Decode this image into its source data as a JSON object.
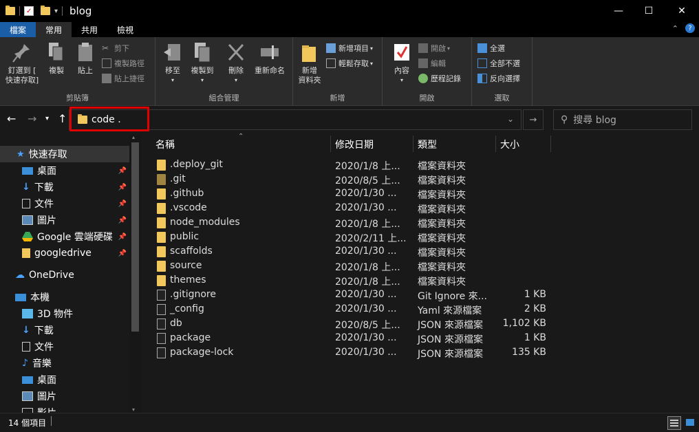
{
  "window": {
    "title": "blog",
    "minimize": "—",
    "maximize": "☐",
    "close": "✕"
  },
  "tabs": [
    {
      "label": "檔案"
    },
    {
      "label": "常用"
    },
    {
      "label": "共用"
    },
    {
      "label": "檢視"
    }
  ],
  "ribbon": {
    "clipboard": {
      "label": "剪貼簿",
      "pin_line1": "釘選到 [",
      "pin_line2": "快速存取]",
      "copy": "複製",
      "paste": "貼上",
      "cut": "剪下",
      "copy_path": "複製路徑",
      "paste_shortcut": "貼上捷徑"
    },
    "organize": {
      "label": "組合管理",
      "move_to": "移至",
      "copy_to": "複製到",
      "delete": "刪除",
      "rename": "重新命名"
    },
    "new": {
      "label": "新增",
      "new_folder_line1": "新增",
      "new_folder_line2": "資料夾",
      "new_item": "新增項目",
      "easy_access": "輕鬆存取"
    },
    "open": {
      "label": "開啟",
      "properties": "內容",
      "open": "開啟",
      "edit": "編輯",
      "history": "歷程記錄"
    },
    "select": {
      "label": "選取",
      "select_all": "全選",
      "select_none": "全部不選",
      "invert": "反向選擇"
    }
  },
  "address": {
    "path": "code .",
    "search_placeholder": "搜尋 blog"
  },
  "sidebar": {
    "items": [
      {
        "label": "快速存取",
        "icon": "star-icon"
      },
      {
        "label": "桌面",
        "icon": "desktop-icon"
      },
      {
        "label": "下載",
        "icon": "download-icon"
      },
      {
        "label": "文件",
        "icon": "document-icon"
      },
      {
        "label": "圖片",
        "icon": "picture-icon"
      },
      {
        "label": "Google 雲端硬碟",
        "icon": "google-drive-icon"
      },
      {
        "label": "googledrive",
        "icon": "folder-icon"
      },
      {
        "label": "OneDrive",
        "icon": "cloud-icon"
      },
      {
        "label": "本機",
        "icon": "computer-icon"
      },
      {
        "label": "3D 物件",
        "icon": "cube-icon"
      },
      {
        "label": "下載",
        "icon": "download-icon"
      },
      {
        "label": "文件",
        "icon": "document-icon"
      },
      {
        "label": "音樂",
        "icon": "music-icon"
      },
      {
        "label": "桌面",
        "icon": "desktop-icon"
      },
      {
        "label": "圖片",
        "icon": "picture-icon"
      },
      {
        "label": "影片",
        "icon": "video-icon"
      }
    ]
  },
  "columns": {
    "name": "名稱",
    "modified": "修改日期",
    "type": "類型",
    "size": "大小"
  },
  "files": [
    {
      "name": ".deploy_git",
      "date": "2020/1/8 上...",
      "type": "檔案資料夾",
      "size": "",
      "kind": "folder"
    },
    {
      "name": ".git",
      "date": "2020/8/5 上...",
      "type": "檔案資料夾",
      "size": "",
      "kind": "folder-dark"
    },
    {
      "name": ".github",
      "date": "2020/1/30 ...",
      "type": "檔案資料夾",
      "size": "",
      "kind": "folder"
    },
    {
      "name": ".vscode",
      "date": "2020/1/30 ...",
      "type": "檔案資料夾",
      "size": "",
      "kind": "folder"
    },
    {
      "name": "node_modules",
      "date": "2020/1/8 上...",
      "type": "檔案資料夾",
      "size": "",
      "kind": "folder"
    },
    {
      "name": "public",
      "date": "2020/2/11 上...",
      "type": "檔案資料夾",
      "size": "",
      "kind": "folder"
    },
    {
      "name": "scaffolds",
      "date": "2020/1/30 ...",
      "type": "檔案資料夾",
      "size": "",
      "kind": "folder"
    },
    {
      "name": "source",
      "date": "2020/1/8 上...",
      "type": "檔案資料夾",
      "size": "",
      "kind": "folder"
    },
    {
      "name": "themes",
      "date": "2020/1/8 上...",
      "type": "檔案資料夾",
      "size": "",
      "kind": "folder"
    },
    {
      "name": ".gitignore",
      "date": "2020/1/30 ...",
      "type": "Git Ignore 來...",
      "size": "1 KB",
      "kind": "doc"
    },
    {
      "name": "_config",
      "date": "2020/1/30 ...",
      "type": "Yaml 來源檔案",
      "size": "2 KB",
      "kind": "doc"
    },
    {
      "name": "db",
      "date": "2020/8/5 上...",
      "type": "JSON 來源檔案",
      "size": "1,102 KB",
      "kind": "doc"
    },
    {
      "name": "package",
      "date": "2020/1/30 ...",
      "type": "JSON 來源檔案",
      "size": "1 KB",
      "kind": "doc"
    },
    {
      "name": "package-lock",
      "date": "2020/1/30 ...",
      "type": "JSON 來源檔案",
      "size": "135 KB",
      "kind": "doc"
    }
  ],
  "status": {
    "count": "14 個項目"
  }
}
